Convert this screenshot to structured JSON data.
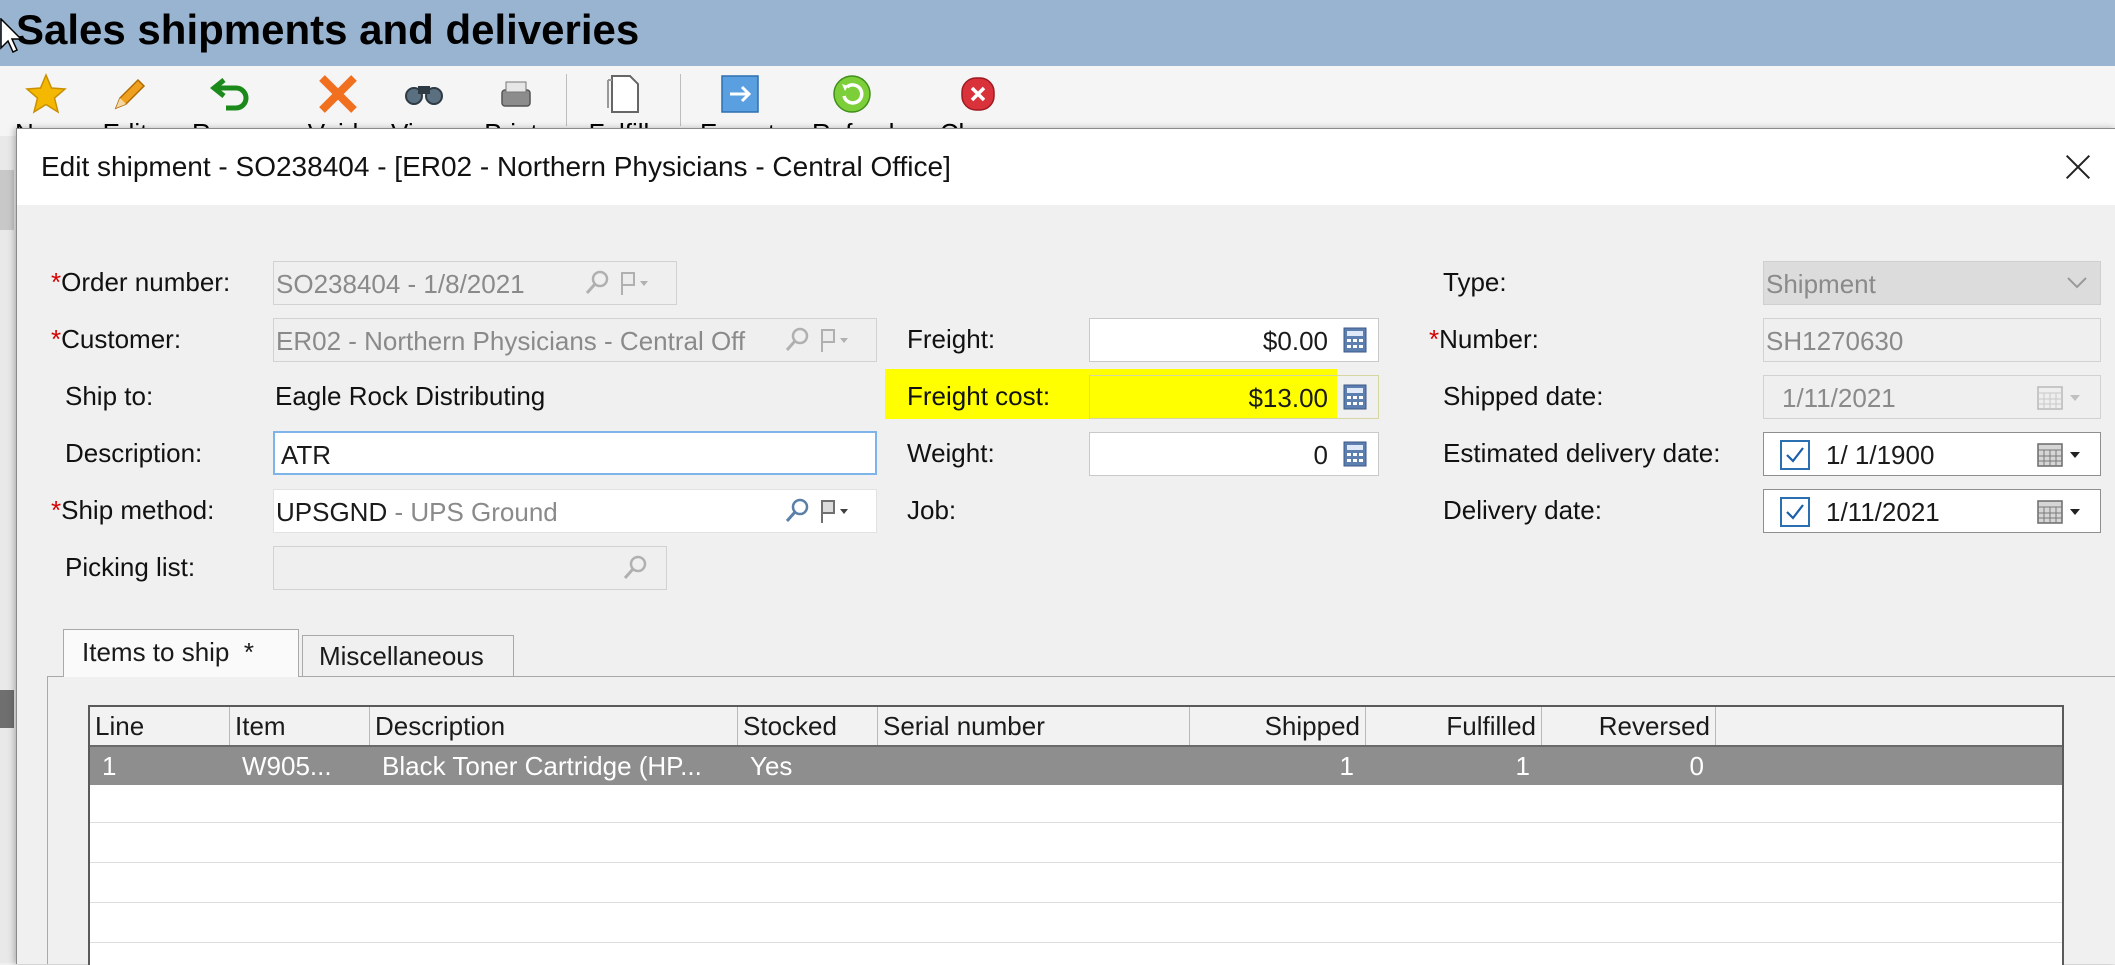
{
  "main": {
    "title": "Sales shipments and deliveries",
    "toolbar": [
      {
        "label": "New",
        "icon": "star-icon"
      },
      {
        "label": "Edit",
        "icon": "pencil-icon"
      },
      {
        "label": "Reverse",
        "icon": "undo-icon"
      },
      {
        "label": "Void",
        "icon": "void-x-icon"
      },
      {
        "label": "View",
        "icon": "binoculars-icon"
      },
      {
        "label": "Print",
        "icon": "printer-icon"
      },
      {
        "label": "Fulfill",
        "icon": "document-icon"
      },
      {
        "label": "Export",
        "icon": "export-icon"
      },
      {
        "label": "Refresh",
        "icon": "refresh-icon"
      },
      {
        "label": "Close",
        "icon": "close-red-icon"
      }
    ]
  },
  "dialog": {
    "title": "Edit shipment - SO238404 - [ER02 - Northern Physicians - Central Office]",
    "left": {
      "order_number_label": "Order number:",
      "order_number_value": "SO238404 - 1/8/2021",
      "customer_label": "Customer:",
      "customer_code": "ER02",
      "customer_name": " - Northern Physicians - Central Off",
      "ship_to_label": "Ship to:",
      "ship_to_value": "Eagle Rock Distributing",
      "description_label": "Description:",
      "description_value": "ATR",
      "ship_method_label": "Ship method:",
      "ship_method_code": "UPSGND",
      "ship_method_name": " - UPS Ground",
      "picking_list_label": "Picking list:",
      "picking_list_value": ""
    },
    "middle": {
      "freight_label": "Freight:",
      "freight_value": "$0.00",
      "freight_cost_label": "Freight cost:",
      "freight_cost_value": "$13.00",
      "weight_label": "Weight:",
      "weight_value": "0",
      "job_label": "Job:"
    },
    "right": {
      "type_label": "Type:",
      "type_value": "Shipment",
      "number_label": "Number:",
      "number_value": "SH1270630",
      "shipped_date_label": "Shipped date:",
      "shipped_date_value": "1/11/2021",
      "est_delivery_label": "Estimated delivery date:",
      "est_delivery_value": "1/  1/1900",
      "est_delivery_checked": true,
      "delivery_date_label": "Delivery date:",
      "delivery_date_value": "1/11/2021",
      "delivery_date_checked": true
    },
    "tabs": [
      {
        "label": "Items to ship  *",
        "active": true
      },
      {
        "label": "Miscellaneous",
        "active": false
      }
    ],
    "grid": {
      "columns": [
        "Line",
        "Item",
        "Description",
        "Stocked",
        "Serial number",
        "Shipped",
        "Fulfilled",
        "Reversed"
      ],
      "rows": [
        {
          "line": "1",
          "item": "W905...",
          "description": "Black Toner Cartridge (HP...",
          "stocked": "Yes",
          "serial": "",
          "shipped": "1",
          "fulfilled": "1",
          "reversed": "0"
        }
      ]
    },
    "highlight_color": "#ffff00"
  }
}
